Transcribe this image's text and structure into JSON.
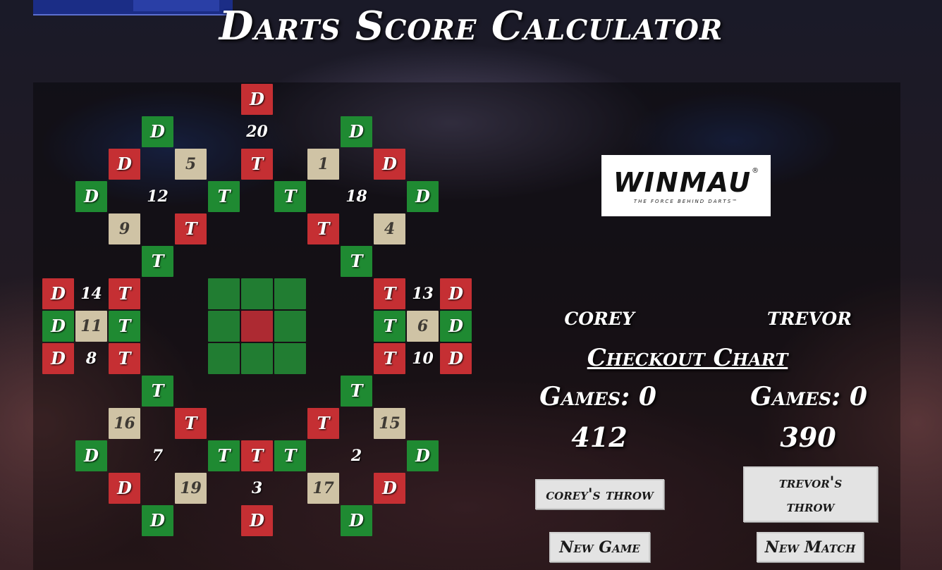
{
  "title": "Darts Score Calculator",
  "board": {
    "cols": 13,
    "cells": [
      {
        "r": 1,
        "c": 7,
        "t": "D",
        "k": "red"
      },
      {
        "r": 2,
        "c": 4,
        "t": "D",
        "k": "green"
      },
      {
        "r": 2,
        "c": 7,
        "t": "20",
        "k": "num"
      },
      {
        "r": 2,
        "c": 10,
        "t": "D",
        "k": "green"
      },
      {
        "r": 3,
        "c": 3,
        "t": "D",
        "k": "red"
      },
      {
        "r": 3,
        "c": 5,
        "t": "5",
        "k": "beige"
      },
      {
        "r": 3,
        "c": 7,
        "t": "T",
        "k": "red"
      },
      {
        "r": 3,
        "c": 9,
        "t": "1",
        "k": "beige"
      },
      {
        "r": 3,
        "c": 11,
        "t": "D",
        "k": "red"
      },
      {
        "r": 4,
        "c": 2,
        "t": "D",
        "k": "green"
      },
      {
        "r": 4,
        "c": 4,
        "t": "12",
        "k": "num"
      },
      {
        "r": 4,
        "c": 6,
        "t": "T",
        "k": "green"
      },
      {
        "r": 4,
        "c": 8,
        "t": "T",
        "k": "green"
      },
      {
        "r": 4,
        "c": 10,
        "t": "18",
        "k": "num"
      },
      {
        "r": 4,
        "c": 12,
        "t": "D",
        "k": "green"
      },
      {
        "r": 5,
        "c": 3,
        "t": "9",
        "k": "beige"
      },
      {
        "r": 5,
        "c": 5,
        "t": "T",
        "k": "red"
      },
      {
        "r": 5,
        "c": 9,
        "t": "T",
        "k": "red"
      },
      {
        "r": 5,
        "c": 11,
        "t": "4",
        "k": "beige"
      },
      {
        "r": 6,
        "c": 4,
        "t": "T",
        "k": "green"
      },
      {
        "r": 6,
        "c": 10,
        "t": "T",
        "k": "green"
      },
      {
        "r": 7,
        "c": 1,
        "t": "D",
        "k": "red"
      },
      {
        "r": 7,
        "c": 2,
        "t": "14",
        "k": "num"
      },
      {
        "r": 7,
        "c": 3,
        "t": "T",
        "k": "red"
      },
      {
        "r": 7,
        "c": 6,
        "t": "",
        "k": "bull-g"
      },
      {
        "r": 7,
        "c": 7,
        "t": "",
        "k": "bull-g"
      },
      {
        "r": 7,
        "c": 8,
        "t": "",
        "k": "bull-g"
      },
      {
        "r": 7,
        "c": 11,
        "t": "T",
        "k": "red"
      },
      {
        "r": 7,
        "c": 12,
        "t": "13",
        "k": "num"
      },
      {
        "r": 7,
        "c": 13,
        "t": "D",
        "k": "red"
      },
      {
        "r": 8,
        "c": 1,
        "t": "D",
        "k": "green"
      },
      {
        "r": 8,
        "c": 2,
        "t": "11",
        "k": "beige"
      },
      {
        "r": 8,
        "c": 3,
        "t": "T",
        "k": "green"
      },
      {
        "r": 8,
        "c": 6,
        "t": "",
        "k": "bull-g"
      },
      {
        "r": 8,
        "c": 7,
        "t": "",
        "k": "bull-r"
      },
      {
        "r": 8,
        "c": 8,
        "t": "",
        "k": "bull-g"
      },
      {
        "r": 8,
        "c": 11,
        "t": "T",
        "k": "green"
      },
      {
        "r": 8,
        "c": 12,
        "t": "6",
        "k": "beige"
      },
      {
        "r": 8,
        "c": 13,
        "t": "D",
        "k": "green"
      },
      {
        "r": 9,
        "c": 1,
        "t": "D",
        "k": "red"
      },
      {
        "r": 9,
        "c": 2,
        "t": "8",
        "k": "num"
      },
      {
        "r": 9,
        "c": 3,
        "t": "T",
        "k": "red"
      },
      {
        "r": 9,
        "c": 6,
        "t": "",
        "k": "bull-g"
      },
      {
        "r": 9,
        "c": 7,
        "t": "",
        "k": "bull-g"
      },
      {
        "r": 9,
        "c": 8,
        "t": "",
        "k": "bull-g"
      },
      {
        "r": 9,
        "c": 11,
        "t": "T",
        "k": "red"
      },
      {
        "r": 9,
        "c": 12,
        "t": "10",
        "k": "num"
      },
      {
        "r": 9,
        "c": 13,
        "t": "D",
        "k": "red"
      },
      {
        "r": 10,
        "c": 4,
        "t": "T",
        "k": "green"
      },
      {
        "r": 10,
        "c": 10,
        "t": "T",
        "k": "green"
      },
      {
        "r": 11,
        "c": 3,
        "t": "16",
        "k": "beige"
      },
      {
        "r": 11,
        "c": 5,
        "t": "T",
        "k": "red"
      },
      {
        "r": 11,
        "c": 9,
        "t": "T",
        "k": "red"
      },
      {
        "r": 11,
        "c": 11,
        "t": "15",
        "k": "beige"
      },
      {
        "r": 12,
        "c": 2,
        "t": "D",
        "k": "green"
      },
      {
        "r": 12,
        "c": 4,
        "t": "7",
        "k": "num"
      },
      {
        "r": 12,
        "c": 6,
        "t": "T",
        "k": "green"
      },
      {
        "r": 12,
        "c": 7,
        "t": "T",
        "k": "red"
      },
      {
        "r": 12,
        "c": 8,
        "t": "T",
        "k": "green"
      },
      {
        "r": 12,
        "c": 10,
        "t": "2",
        "k": "num"
      },
      {
        "r": 12,
        "c": 12,
        "t": "D",
        "k": "green"
      },
      {
        "r": 13,
        "c": 3,
        "t": "D",
        "k": "red"
      },
      {
        "r": 13,
        "c": 5,
        "t": "19",
        "k": "beige"
      },
      {
        "r": 13,
        "c": 7,
        "t": "3",
        "k": "num"
      },
      {
        "r": 13,
        "c": 9,
        "t": "17",
        "k": "beige"
      },
      {
        "r": 13,
        "c": 11,
        "t": "D",
        "k": "red"
      },
      {
        "r": 14,
        "c": 4,
        "t": "D",
        "k": "green"
      },
      {
        "r": 14,
        "c": 7,
        "t": "D",
        "k": "red"
      },
      {
        "r": 14,
        "c": 10,
        "t": "D",
        "k": "green"
      }
    ]
  },
  "logo": {
    "word": "WINMAU",
    "mark": "®",
    "tagline": "THE FORCE BEHIND DARTS™"
  },
  "players": [
    {
      "name": "corey",
      "games": "Games: 0",
      "score": "412",
      "throw_label": "corey's throw"
    },
    {
      "name": "trevor",
      "games": "Games: 0",
      "score": "390",
      "throw_label": "trevor's throw"
    }
  ],
  "checkout_label": "Checkout Chart",
  "new_game_label": "New Game",
  "new_match_label": "New Match",
  "colors": {
    "red": "#c52f33",
    "green": "#1f8a32",
    "beige": "#cfc3a5"
  }
}
